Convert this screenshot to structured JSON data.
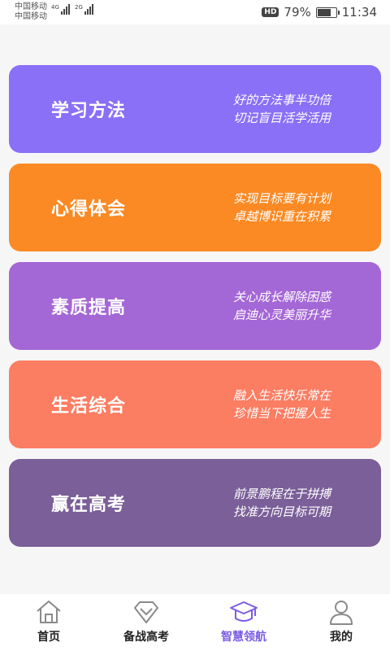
{
  "status_bar": {
    "carrier_1": "中国移动",
    "carrier_2": "中国移动",
    "net_1": "4G",
    "net_2": "2G",
    "hd": "HD",
    "battery_percent": "79%",
    "battery_level": 0.79,
    "time": "11:34"
  },
  "cards": [
    {
      "title": "学习方法",
      "line1": "好的方法事半功倍",
      "line2": "切记盲目活学活用",
      "color": "#8a6ff7"
    },
    {
      "title": "心得体会",
      "line1": "实现目标要有计划",
      "line2": "卓越博识重在积累",
      "color": "#fb8a24"
    },
    {
      "title": "素质提高",
      "line1": "关心成长解除困惑",
      "line2": "启迪心灵美丽升华",
      "color": "#a467d6"
    },
    {
      "title": "生活综合",
      "line1": "融入生活快乐常在",
      "line2": "珍惜当下把握人生",
      "color": "#fb7d62"
    },
    {
      "title": "赢在高考",
      "line1": "前景鹏程在于拼搏",
      "line2": "找准方向目标可期",
      "color": "#7a5f98"
    }
  ],
  "tabs": [
    {
      "label": "首页",
      "icon": "home-icon"
    },
    {
      "label": "备战高考",
      "icon": "diamond-icon"
    },
    {
      "label": "智慧领航",
      "icon": "graduation-cap-icon",
      "active": true
    },
    {
      "label": "我的",
      "icon": "user-icon"
    }
  ],
  "colors": {
    "active_tab": "#7b5ce6",
    "inactive_icon": "#8a8a8a"
  }
}
